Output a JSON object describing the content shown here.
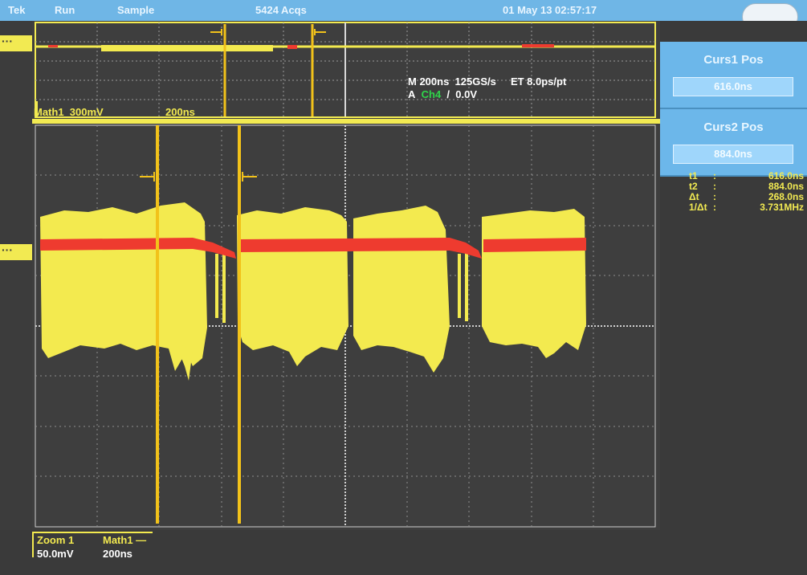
{
  "status_bar": {
    "brand": "Tek",
    "mode": "Run",
    "acquisition": "Sample",
    "acq_count": "5424 Acqs",
    "datetime": "01 May 13 02:57:17"
  },
  "overview": {
    "math_label": "Math1",
    "math_scale": "300mV",
    "time_scale": "200ns",
    "timebase": "M 200ns",
    "sample_rate": "125GS/s",
    "et": "ET 8.0ps/pt",
    "trigger_prefix": "A",
    "trigger_channel": "Ch4",
    "trigger_slope": "/",
    "trigger_level": "0.0V"
  },
  "cursors": {
    "curs1_title": "Curs1 Pos",
    "curs1_value": "616.0ns",
    "curs2_title": "Curs2 Pos",
    "curs2_value": "884.0ns"
  },
  "readouts": [
    {
      "label": "t1",
      "value": "616.0ns"
    },
    {
      "label": "t2",
      "value": "884.0ns"
    },
    {
      "label": "Δt",
      "value": "268.0ns"
    },
    {
      "label": "1/Δt",
      "value": "3.731MHz"
    }
  ],
  "bottom": {
    "zoom_label": "Zoom 1",
    "zoom_scale": "50.0mV",
    "math_label": "Math1 —",
    "math_time": "200ns"
  },
  "colors": {
    "screen_bg": "#3e3e3e",
    "grid": "#bdbdbd",
    "trace_yellow": "#f3ea4f",
    "trace_red": "#ee3b2f",
    "cursor": "#f2c21a",
    "panel_blue": "#6cb7ea",
    "trigger_channel": "#2fd64a"
  }
}
